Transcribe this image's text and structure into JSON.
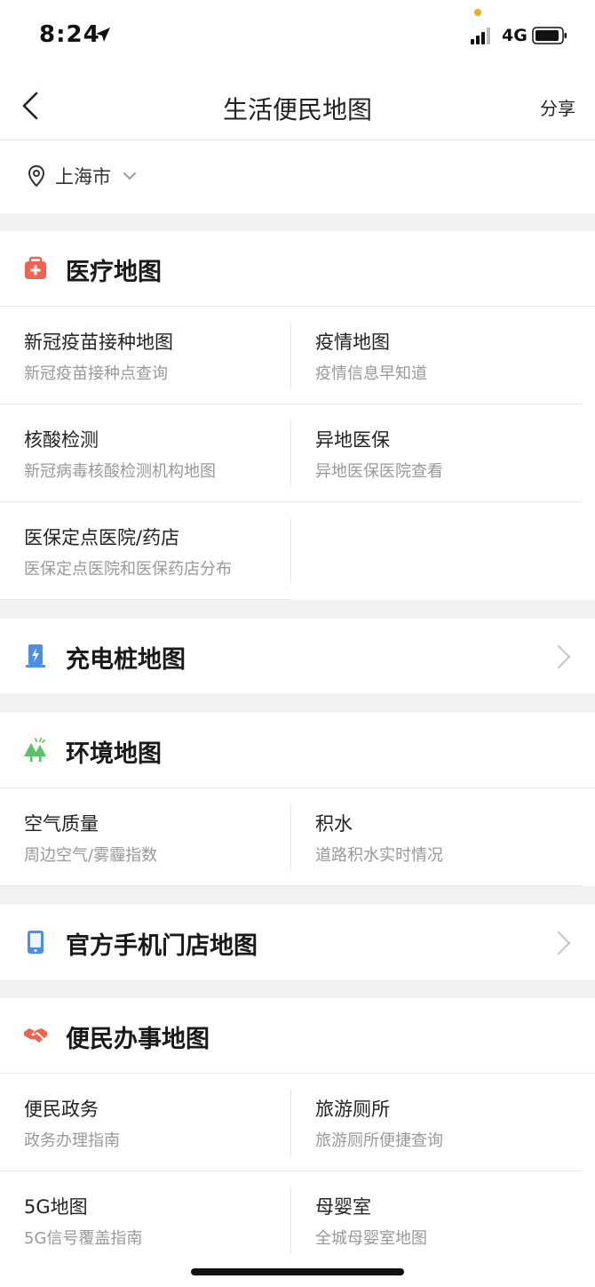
{
  "status_bar": {
    "time": "8:24",
    "network": "4G"
  },
  "nav": {
    "title": "生活便民地图",
    "share_label": "分享"
  },
  "location": {
    "city": "上海市"
  },
  "sections": {
    "medical": {
      "title": "医疗地图",
      "items": [
        {
          "title": "新冠疫苗接种地图",
          "subtitle": "新冠疫苗接种点查询"
        },
        {
          "title": "疫情地图",
          "subtitle": "疫情信息早知道"
        },
        {
          "title": "核酸检测",
          "subtitle": "新冠病毒核酸检测机构地图"
        },
        {
          "title": "异地医保",
          "subtitle": "异地医保医院查看"
        },
        {
          "title": "医保定点医院/药店",
          "subtitle": "医保定点医院和医保药店分布"
        }
      ]
    },
    "charging": {
      "title": "充电桩地图"
    },
    "environment": {
      "title": "环境地图",
      "items": [
        {
          "title": "空气质量",
          "subtitle": "周边空气/雾霾指数"
        },
        {
          "title": "积水",
          "subtitle": "道路积水实时情况"
        }
      ]
    },
    "phone_store": {
      "title": "官方手机门店地图"
    },
    "services": {
      "title": "便民办事地图",
      "items": [
        {
          "title": "便民政务",
          "subtitle": "政务办理指南"
        },
        {
          "title": "旅游厕所",
          "subtitle": "旅游厕所便捷查询"
        },
        {
          "title": "5G地图",
          "subtitle": "5G信号覆盖指南"
        },
        {
          "title": "母婴室",
          "subtitle": "全城母婴室地图"
        }
      ]
    }
  },
  "colors": {
    "medical_icon": "#f0634f",
    "charging_icon": "#4a90e2",
    "environment_icon": "#5cc26a",
    "phone_icon": "#4a90e2",
    "services_icon": "#f0634f"
  }
}
